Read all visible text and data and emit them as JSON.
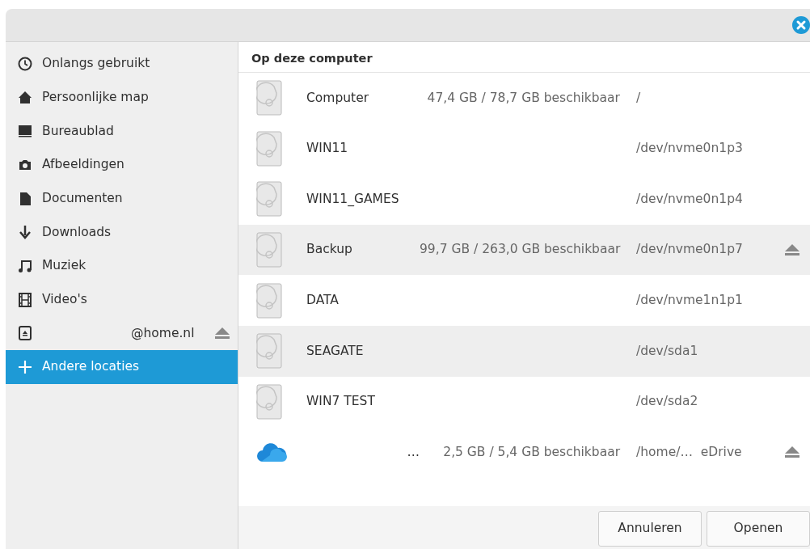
{
  "sidebar": {
    "items": [
      {
        "label": "Onlangs gebruikt",
        "selected": false
      },
      {
        "label": "Persoonlijke map",
        "selected": false
      },
      {
        "label": "Bureaublad",
        "selected": false
      },
      {
        "label": "Afbeeldingen",
        "selected": false
      },
      {
        "label": "Documenten",
        "selected": false
      },
      {
        "label": "Downloads",
        "selected": false
      },
      {
        "label": "Muziek",
        "selected": false
      },
      {
        "label": "Video's",
        "selected": false
      },
      {
        "label": "@home.nl",
        "selected": false,
        "eject": true
      },
      {
        "label": "Andere locaties",
        "selected": true
      }
    ]
  },
  "section_title": "Op deze computer",
  "locations": [
    {
      "name": "Computer",
      "kind": "drive",
      "space": "47,4 GB / 78,7 GB beschikbaar",
      "path": "/",
      "highlighted": false,
      "eject": false
    },
    {
      "name": "WIN11",
      "kind": "drive",
      "path": "/dev/nvme0n1p3",
      "highlighted": false,
      "eject": false
    },
    {
      "name": "WIN11_GAMES",
      "kind": "drive",
      "path": "/dev/nvme0n1p4",
      "highlighted": false,
      "eject": false
    },
    {
      "name": "Backup",
      "kind": "drive",
      "space": "99,7 GB / 263,0 GB beschikbaar",
      "path": "/dev/nvme0n1p7",
      "highlighted": true,
      "eject": true
    },
    {
      "name": "DATA",
      "kind": "drive",
      "path": "/dev/nvme1n1p1",
      "highlighted": false,
      "eject": false
    },
    {
      "name": "SEAGATE",
      "kind": "drive",
      "path": "/dev/sda1",
      "highlighted": true,
      "eject": false
    },
    {
      "name": "WIN7 TEST",
      "kind": "drive",
      "path": "/dev/sda2",
      "highlighted": false,
      "eject": false
    },
    {
      "name": "…",
      "kind": "cloud",
      "space": "2,5 GB / 5,4 GB beschikbaar",
      "path": "/home/…  eDrive",
      "highlighted": false,
      "eject": true
    }
  ],
  "buttons": [
    "Annuleren",
    "Openen"
  ]
}
